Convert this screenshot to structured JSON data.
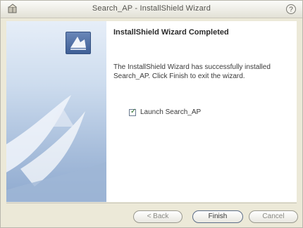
{
  "window": {
    "title": "Search_AP - InstallShield Wizard"
  },
  "content": {
    "heading": "InstallShield Wizard Completed",
    "body": "The InstallShield Wizard has successfully installed Search_AP. Click Finish to exit the wizard.",
    "launch_label": "Launch Search_AP",
    "launch_checked": true
  },
  "buttons": {
    "back": "< Back",
    "finish": "Finish",
    "cancel": "Cancel"
  },
  "icons": {
    "app": "installer-icon",
    "help": "help-icon",
    "logo": "installshield-logo-icon"
  }
}
